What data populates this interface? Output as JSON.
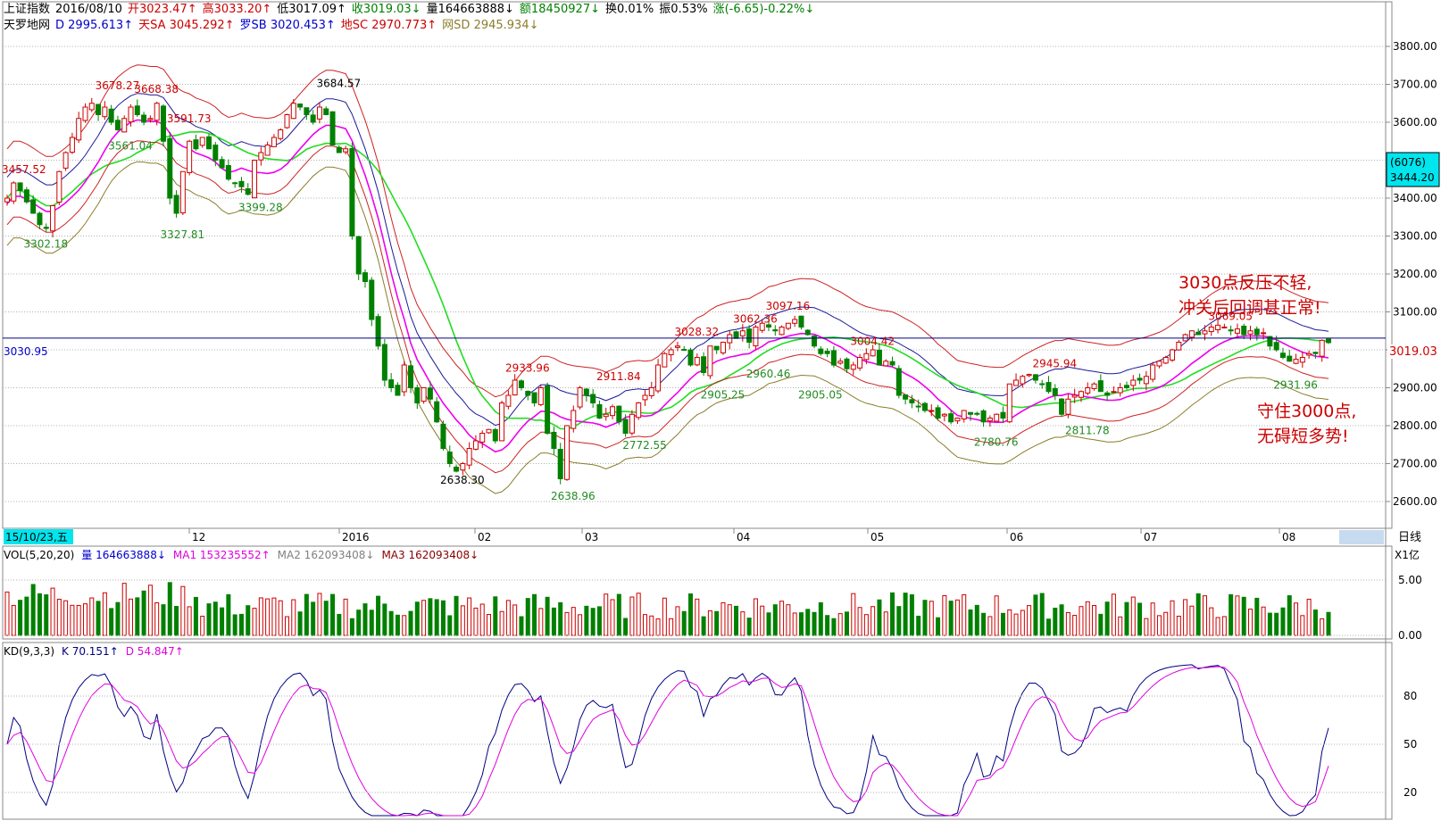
{
  "header": {
    "line1": [
      {
        "text": "上证指数",
        "color": "#000000"
      },
      {
        "text": "2016/08/10",
        "color": "#000000"
      },
      {
        "text": "开3023.47↑",
        "color": "#cc0000"
      },
      {
        "text": "高3033.20↑",
        "color": "#cc0000"
      },
      {
        "text": "低3017.09↑",
        "color": "#000000"
      },
      {
        "text": "收3019.03↓",
        "color": "#008000"
      },
      {
        "text": "量164663888↓",
        "color": "#000000"
      },
      {
        "text": "额18450927↓",
        "color": "#008000"
      },
      {
        "text": "换0.01%",
        "color": "#000000"
      },
      {
        "text": "振0.53%",
        "color": "#000000"
      },
      {
        "text": "涨(-6.65)-0.22%↓",
        "color": "#008000"
      }
    ],
    "line2": [
      {
        "text": "天罗地网",
        "color": "#000000"
      },
      {
        "text": "D 2995.613↑",
        "color": "#0000cc"
      },
      {
        "text": "天SA 3045.292↑",
        "color": "#cc0000"
      },
      {
        "text": "罗SB 3020.453↑",
        "color": "#0000cc"
      },
      {
        "text": "地SC 2970.773↑",
        "color": "#cc0000"
      },
      {
        "text": "网SD 2945.934↓",
        "color": "#8b7d2a"
      }
    ]
  },
  "price_axis": {
    "ticks": [
      "3800.00",
      "3700.00",
      "3600.00",
      "3500.00",
      "3400.00",
      "3300.00",
      "3200.00",
      "3100.00",
      "3000.00",
      "2900.00",
      "2800.00",
      "2700.00",
      "2600.00"
    ],
    "current_label": "3019.03",
    "cursor_label_top": "(6076)",
    "cursor_label_bottom": "3444.20"
  },
  "time_axis": {
    "date_label": "15/10/23,五",
    "months": [
      "12",
      "2016",
      "02",
      "03",
      "04",
      "05",
      "06",
      "07",
      "08"
    ],
    "period_label": "日线"
  },
  "left_line_label": "3030.95",
  "annotations_top": [
    "3030点反压不轻,",
    "冲关后回调甚正常!"
  ],
  "annotations_bottom": [
    "守住3000点,",
    "无碍短多势!"
  ],
  "price_labels": [
    {
      "text": "3457.52",
      "color": "#cc0000"
    },
    {
      "text": "3302.18",
      "color": "#228b22"
    },
    {
      "text": "3678.27",
      "color": "#cc0000"
    },
    {
      "text": "3668.38",
      "color": "#cc0000"
    },
    {
      "text": "3561.04",
      "color": "#228b22"
    },
    {
      "text": "3591.73",
      "color": "#cc0000"
    },
    {
      "text": "3327.81",
      "color": "#228b22"
    },
    {
      "text": "3399.28",
      "color": "#228b22"
    },
    {
      "text": "3684.57",
      "color": "#000000"
    },
    {
      "text": "2638.30",
      "color": "#000000"
    },
    {
      "text": "2933.96",
      "color": "#cc0000"
    },
    {
      "text": "2638.96",
      "color": "#228b22"
    },
    {
      "text": "2911.84",
      "color": "#cc0000"
    },
    {
      "text": "2772.55",
      "color": "#228b22"
    },
    {
      "text": "3028.32",
      "color": "#cc0000"
    },
    {
      "text": "2905.25",
      "color": "#228b22"
    },
    {
      "text": "3062.36",
      "color": "#cc0000"
    },
    {
      "text": "3097.16",
      "color": "#cc0000"
    },
    {
      "text": "2960.46",
      "color": "#228b22"
    },
    {
      "text": "2905.05",
      "color": "#228b22"
    },
    {
      "text": "3004.42",
      "color": "#cc0000"
    },
    {
      "text": "2945.94",
      "color": "#cc0000"
    },
    {
      "text": "2780.76",
      "color": "#228b22"
    },
    {
      "text": "2811.78",
      "color": "#228b22"
    },
    {
      "text": "3069.05",
      "color": "#cc0000"
    },
    {
      "text": "2931.96",
      "color": "#228b22"
    }
  ],
  "volume_panel": {
    "legend": [
      {
        "text": "VOL(5,20,20)",
        "color": "#000000"
      },
      {
        "text": "量 164663888↓",
        "color": "#0000cc"
      },
      {
        "text": "MA1 153235552↑",
        "color": "#e000e0"
      },
      {
        "text": "MA2 162093408↓",
        "color": "#808080"
      },
      {
        "text": "MA3 162093408↓",
        "color": "#8b0000"
      }
    ],
    "unit_label": "X1亿",
    "ticks": [
      "5.00",
      "0.00"
    ]
  },
  "kd_panel": {
    "legend": [
      {
        "text": "KD(9,3,3)",
        "color": "#000000"
      },
      {
        "text": "K 70.151↑",
        "color": "#000080"
      },
      {
        "text": "D 54.847↑",
        "color": "#e000e0"
      }
    ],
    "ticks": [
      "80",
      "50",
      "20"
    ]
  },
  "chart_data": {
    "type": "candlestick",
    "symbol": "上证指数",
    "period": "日线",
    "ylim": [
      2560,
      3860
    ],
    "horizontal_line": 3030.95,
    "closes": [
      3400,
      3440,
      3420,
      3390,
      3360,
      3330,
      3320,
      3380,
      3470,
      3520,
      3560,
      3610,
      3640,
      3650,
      3620,
      3640,
      3600,
      3580,
      3610,
      3640,
      3620,
      3600,
      3610,
      3650,
      3550,
      3400,
      3360,
      3470,
      3550,
      3530,
      3560,
      3530,
      3500,
      3480,
      3450,
      3440,
      3430,
      3410,
      3500,
      3520,
      3540,
      3560,
      3580,
      3620,
      3650,
      3640,
      3620,
      3600,
      3640,
      3620,
      3540,
      3520,
      3530,
      3300,
      3200,
      3180,
      3080,
      3010,
      2920,
      2900,
      2880,
      2960,
      2900,
      2860,
      2900,
      2870,
      2810,
      2740,
      2700,
      2680,
      2700,
      2740,
      2760,
      2780,
      2790,
      2760,
      2860,
      2880,
      2920,
      2900,
      2880,
      2860,
      2900,
      2780,
      2740,
      2660,
      2800,
      2840,
      2900,
      2880,
      2860,
      2820,
      2830,
      2850,
      2810,
      2780,
      2830,
      2860,
      2880,
      2900,
      2960,
      2990,
      3000,
      3010,
      3000,
      2960,
      2980,
      2940,
      3010,
      3000,
      3020,
      3040,
      3030,
      3050,
      3020,
      3060,
      3070,
      3060,
      3050,
      3060,
      3070,
      3080,
      3060,
      3040,
      3010,
      2990,
      2990,
      2960,
      2970,
      2950,
      2960,
      2980,
      2990,
      3000,
      2960,
      2970,
      2960,
      2880,
      2870,
      2860,
      2850,
      2840,
      2840,
      2820,
      2830,
      2810,
      2820,
      2840,
      2830,
      2830,
      2810,
      2820,
      2830,
      2820,
      2910,
      2920,
      2930,
      2935,
      2920,
      2910,
      2890,
      2880,
      2830,
      2870,
      2880,
      2890,
      2900,
      2910,
      2890,
      2880,
      2890,
      2900,
      2900,
      2920,
      2920,
      2930,
      2960,
      2970,
      2980,
      3000,
      3020,
      3040,
      3050,
      3040,
      3050,
      3060,
      3065,
      3060,
      3050,
      3055,
      3040,
      3050,
      3040,
      3045,
      3010,
      3000,
      2980,
      2970,
      2975,
      2980,
      2990,
      2990,
      3025,
      3019
    ]
  }
}
